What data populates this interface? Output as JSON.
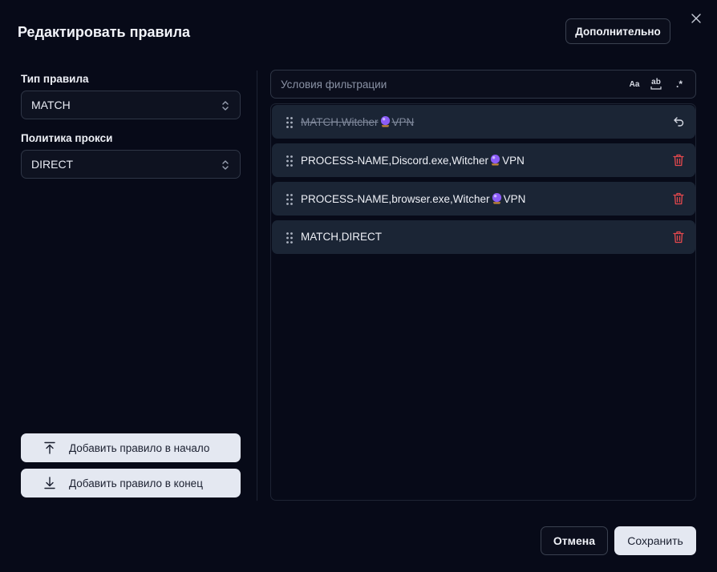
{
  "dialog": {
    "title": "Редактировать правила",
    "advanced_label": "Дополнительно",
    "cancel_label": "Отмена",
    "save_label": "Сохранить"
  },
  "form": {
    "rule_type_label": "Тип правила",
    "rule_type_value": "MATCH",
    "proxy_policy_label": "Политика прокси",
    "proxy_policy_value": "DIRECT",
    "prepend_label": "Добавить правило в начало",
    "append_label": "Добавить правило в конец"
  },
  "filter": {
    "placeholder": "Условия фильтрации",
    "options": [
      "Aa",
      "ab",
      ".*"
    ]
  },
  "rules": [
    {
      "before": "MATCH,Witcher",
      "after": "VPN",
      "deleted": true
    },
    {
      "before": "PROCESS-NAME,Discord.exe,Witcher",
      "after": "VPN",
      "deleted": false
    },
    {
      "before": "PROCESS-NAME,browser.exe,Witcher",
      "after": "VPN",
      "deleted": false
    },
    {
      "before": "MATCH,DIRECT",
      "after": "",
      "deleted": false
    }
  ],
  "colors": {
    "delete_icon": "#e5484d",
    "globe": "#8b5cf6"
  }
}
